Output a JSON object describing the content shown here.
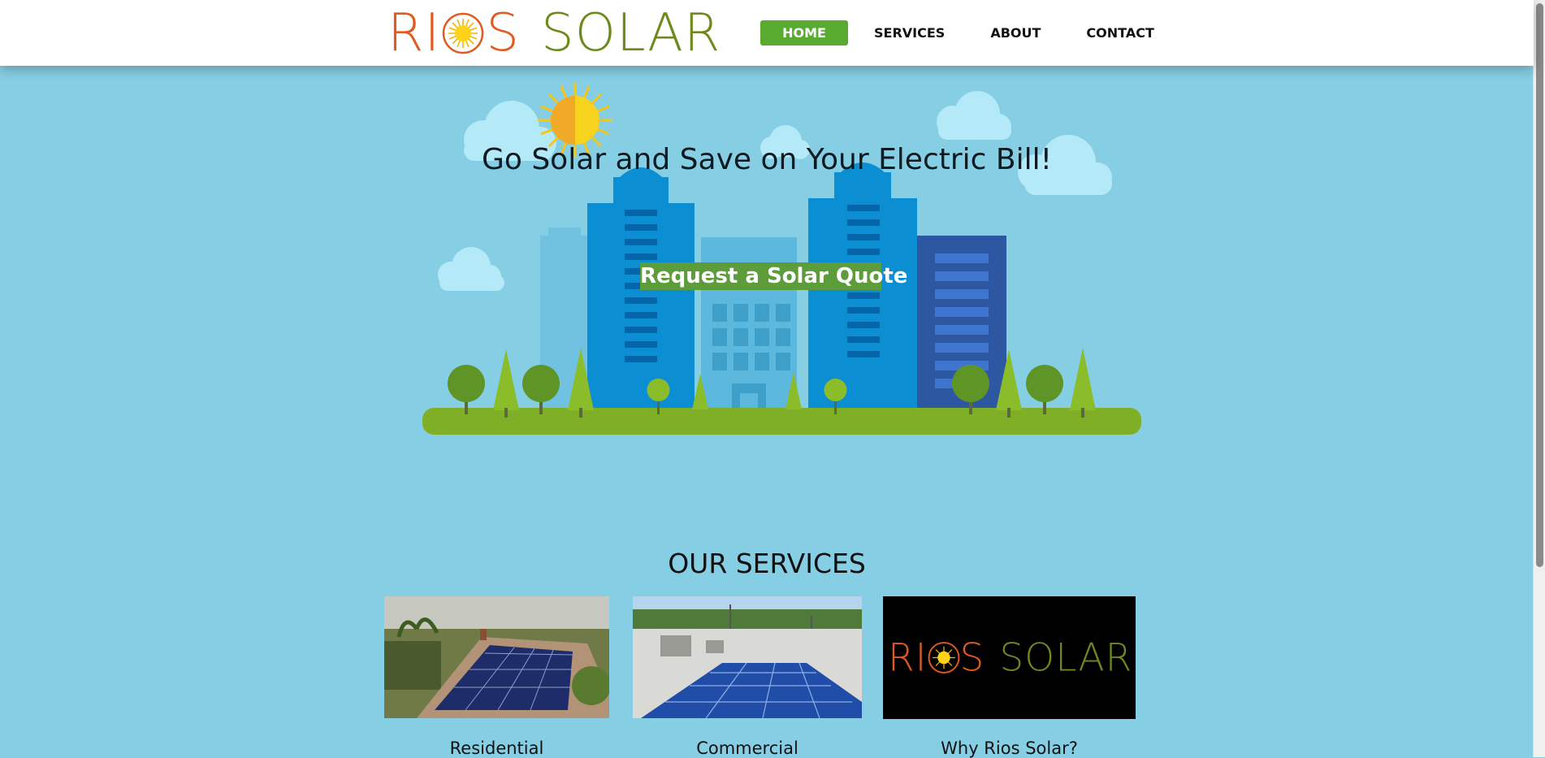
{
  "header": {
    "logo": {
      "part1": "RI",
      "part2": "S",
      "part3": "SOLAR"
    },
    "nav": [
      {
        "label": "HOME"
      },
      {
        "label": "SERVICES"
      },
      {
        "label": "ABOUT"
      },
      {
        "label": "CONTACT"
      }
    ]
  },
  "hero": {
    "title": "Go Solar and Save on Your Electric Bill!",
    "cta_label": "Request a Solar Quote"
  },
  "services": {
    "heading": "OUR SERVICES",
    "cards": [
      {
        "caption": "Residential"
      },
      {
        "caption": "Commercial"
      },
      {
        "caption": "Why Rios Solar?",
        "logo": {
          "part1": "RI",
          "part2": "S",
          "part3": "SOLAR"
        }
      }
    ]
  },
  "colors": {
    "page_bg": "#86cee4",
    "nav_active": "#59ab2f",
    "logo_orange": "#e05a22",
    "logo_green": "#6e8a1c",
    "cta_bg": "#5c9c3a"
  },
  "icons": [
    "sun-icon",
    "cloud-icon",
    "tree-icon"
  ]
}
